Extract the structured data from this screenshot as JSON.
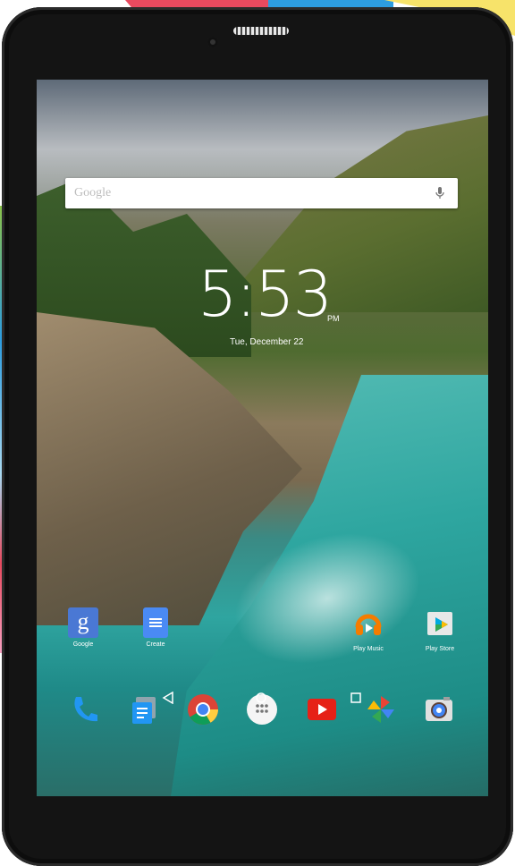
{
  "search": {
    "placeholder": "Google"
  },
  "clock": {
    "time": "5:53",
    "ampm": "PM",
    "date": "Tue, December 22"
  },
  "home_apps": [
    {
      "label": "Google",
      "icon": "google-search-icon"
    },
    {
      "label": "Create",
      "icon": "docs-icon"
    },
    {
      "label": "Play Music",
      "icon": "headphones-icon"
    },
    {
      "label": "Play Store",
      "icon": "play-store-icon"
    }
  ],
  "dock": [
    {
      "icon": "phone-icon"
    },
    {
      "icon": "messages-icon"
    },
    {
      "icon": "chrome-icon"
    },
    {
      "icon": "app-drawer-icon"
    },
    {
      "icon": "youtube-icon"
    },
    {
      "icon": "photos-icon"
    },
    {
      "icon": "camera-icon"
    }
  ],
  "nav": [
    {
      "icon": "back-icon"
    },
    {
      "icon": "home-icon"
    },
    {
      "icon": "recents-icon"
    }
  ],
  "colors": {
    "bezel": "#141414",
    "google_blue": "#4285f4",
    "accent_orange": "#f57c00"
  }
}
